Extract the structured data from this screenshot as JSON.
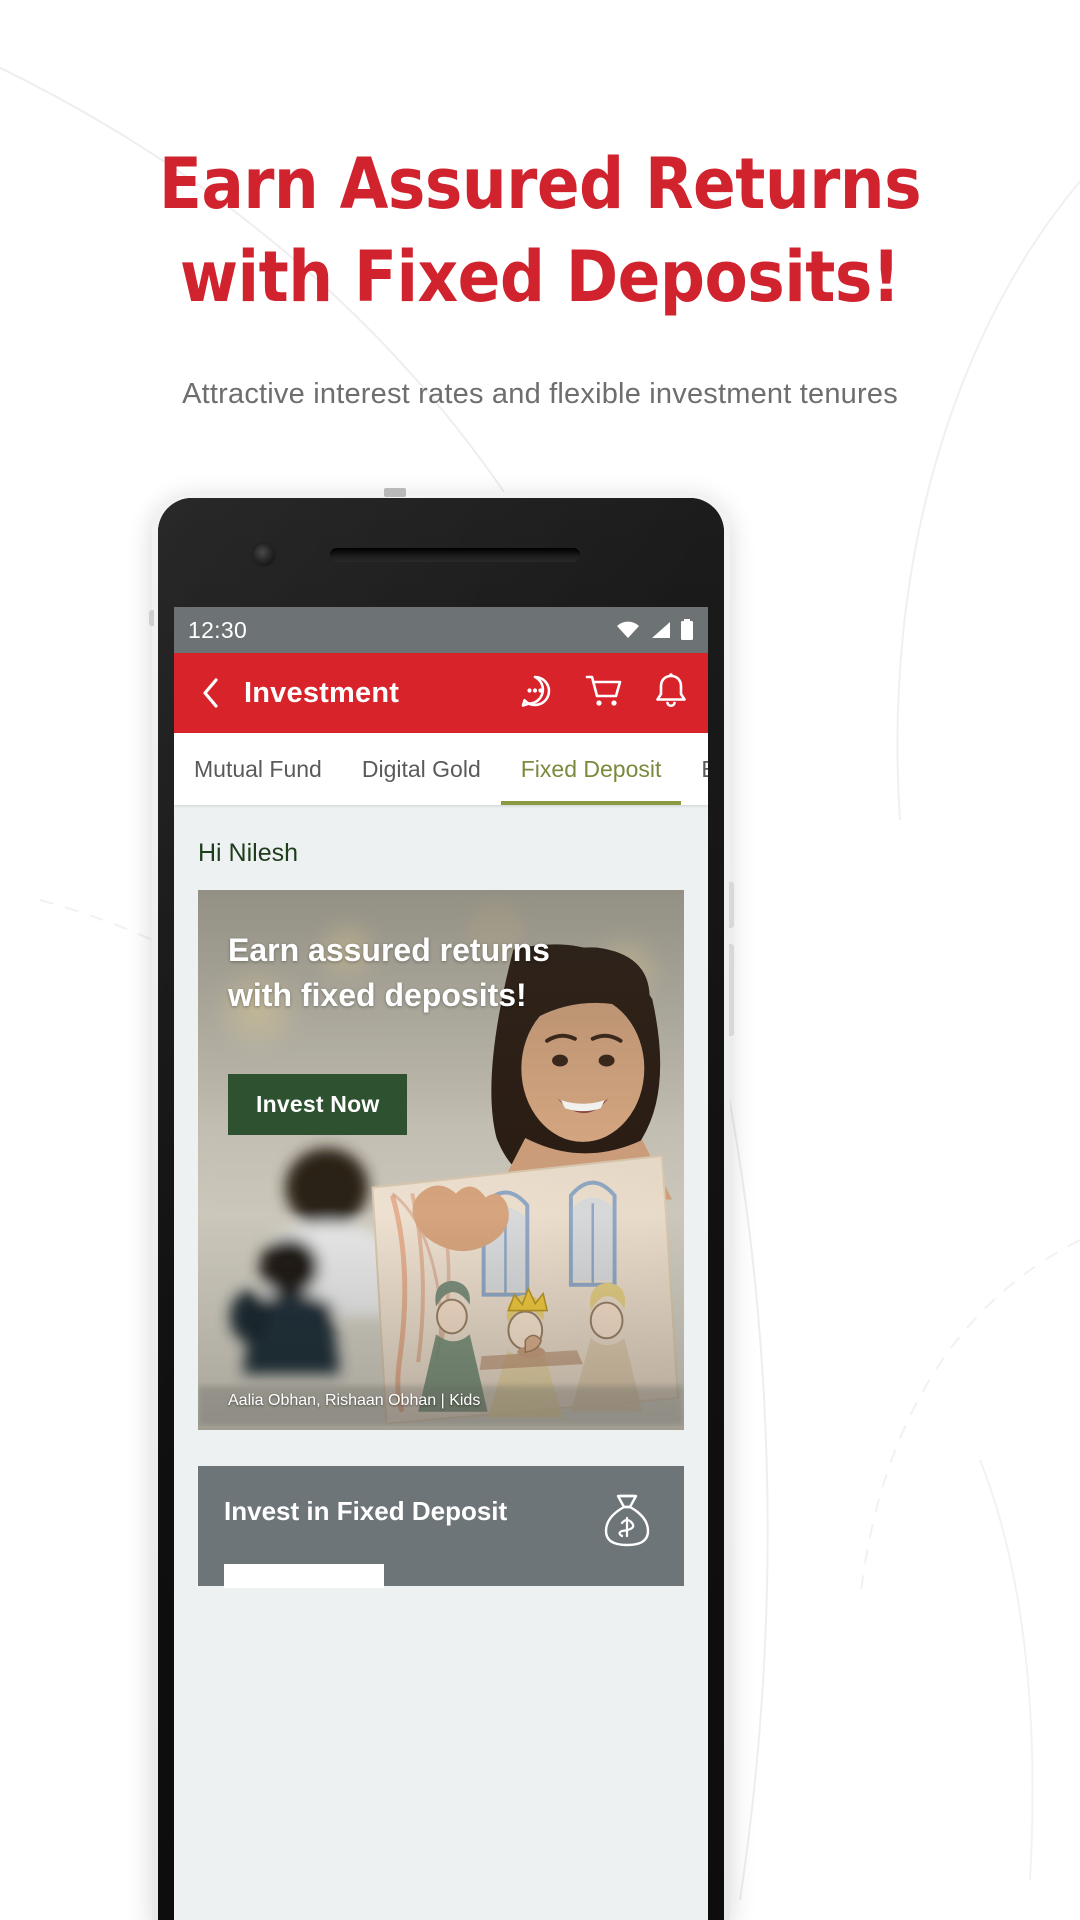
{
  "promo": {
    "title_line1": "Earn Assured Returns",
    "title_line2": "with Fixed Deposits!",
    "subtitle": "Attractive interest rates and flexible investment tenures",
    "accent_color": "#d0232e",
    "subtitle_color": "#6e6e6e"
  },
  "phone": {
    "statusbar": {
      "time": "12:30",
      "icons": [
        "wifi-icon",
        "signal-icon",
        "battery-icon"
      ]
    },
    "appbar": {
      "back_icon": "chevron-left-icon",
      "title": "Investment",
      "actions": [
        {
          "name": "chat-icon",
          "label": "Chat"
        },
        {
          "name": "cart-icon",
          "label": "Cart"
        },
        {
          "name": "bell-icon",
          "label": "Notifications"
        }
      ],
      "bg_color": "#d8232a"
    },
    "tabs": [
      {
        "label": "Mutual Fund",
        "active": false
      },
      {
        "label": "Digital Gold",
        "active": false
      },
      {
        "label": "Fixed Deposit",
        "active": true
      },
      {
        "label": "Equity",
        "active": false
      }
    ],
    "tab_active_color": "#7a8a3c",
    "content": {
      "greeting": "Hi Nilesh",
      "hero": {
        "headline_line1": "Earn assured returns",
        "headline_line2": "with fixed deposits!",
        "cta_label": "Invest Now",
        "cta_color": "#2e5230",
        "credit": "Aalia Obhan, Rishaan Obhan | Kids"
      },
      "fd_card": {
        "title": "Invest in Fixed Deposit",
        "icon": "money-bag-icon",
        "bg_color": "#6e7579"
      }
    }
  }
}
